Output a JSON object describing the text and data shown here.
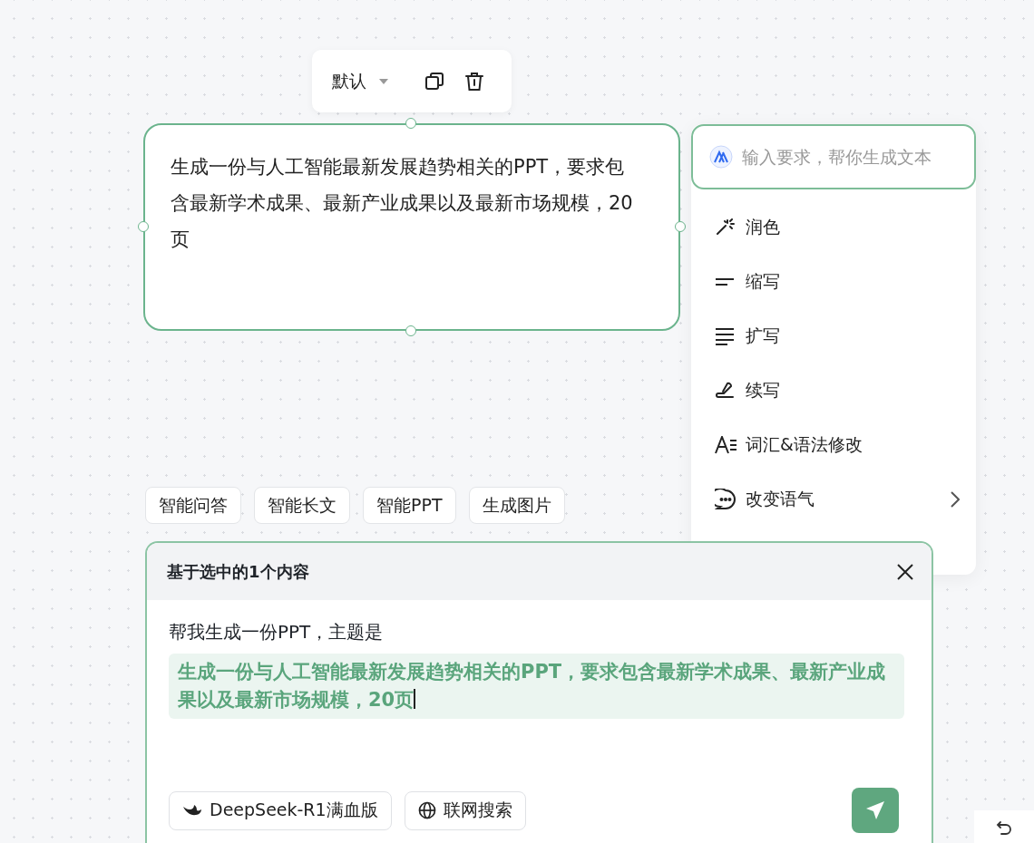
{
  "toolbar": {
    "style_label": "默认"
  },
  "node": {
    "text": "生成一份与人工智能最新发展趋势相关的PPT，要求包含最新学术成果、最新产业成果以及最新市场规模，20页",
    "selected": true
  },
  "ai_menu": {
    "placeholder": "输入要求，帮你生成文本",
    "items": [
      {
        "label": "润色",
        "has_submenu": false
      },
      {
        "label": "缩写",
        "has_submenu": false
      },
      {
        "label": "扩写",
        "has_submenu": false
      },
      {
        "label": "续写",
        "has_submenu": false
      },
      {
        "label": "词汇&语法修改",
        "has_submenu": false
      },
      {
        "label": "改变语气",
        "has_submenu": true
      }
    ]
  },
  "chips": [
    "智能问答",
    "智能长文",
    "智能PPT",
    "生成图片"
  ],
  "dialog": {
    "title": "基于选中的1个内容",
    "prompt": "帮我生成一份PPT，主题是",
    "quoted_content": "生成一份与人工智能最新发展趋势相关的PPT，要求包含最新学术成果、最新产业成果以及最新市场规模，20页",
    "options": [
      {
        "label": "DeepSeek-R1满血版"
      },
      {
        "label": "联网搜索"
      }
    ]
  }
}
